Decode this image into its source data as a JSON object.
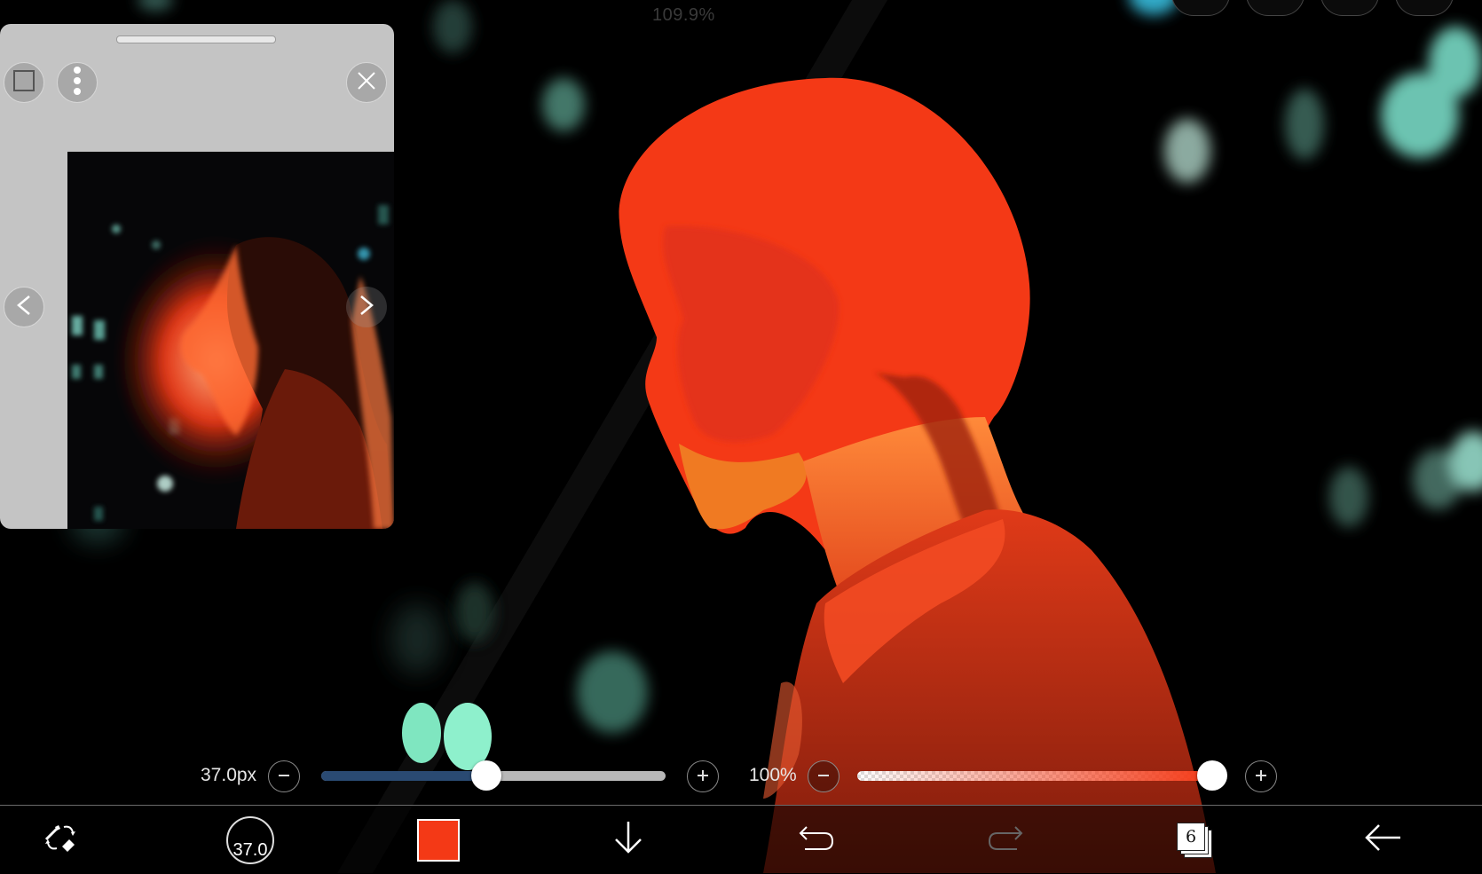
{
  "canvas": {
    "zoom": "109.9%"
  },
  "reference_window": {
    "title_icons": [
      "square-icon",
      "more-vertical-icon",
      "close-icon"
    ],
    "nav": [
      "chevron-left-icon",
      "chevron-right-icon"
    ]
  },
  "brush": {
    "size_label": "37.0px",
    "size_fraction": 0.48,
    "opacity_label": "100%",
    "opacity_fraction": 1.0
  },
  "toolbar": {
    "brush_size_value": "37.0",
    "color": "#f43916",
    "layers_count": "6",
    "items": [
      "brush-eraser-toggle-icon",
      "brush-size-indicator",
      "color-swatch",
      "download-icon",
      "undo-icon",
      "redo-icon",
      "layers-icon",
      "back-icon"
    ]
  },
  "colors": {
    "accent_red": "#f43916",
    "size_track": "#2a4a72",
    "track_bg": "#b8b8b8",
    "teal_paint": "#7fe6c0"
  }
}
